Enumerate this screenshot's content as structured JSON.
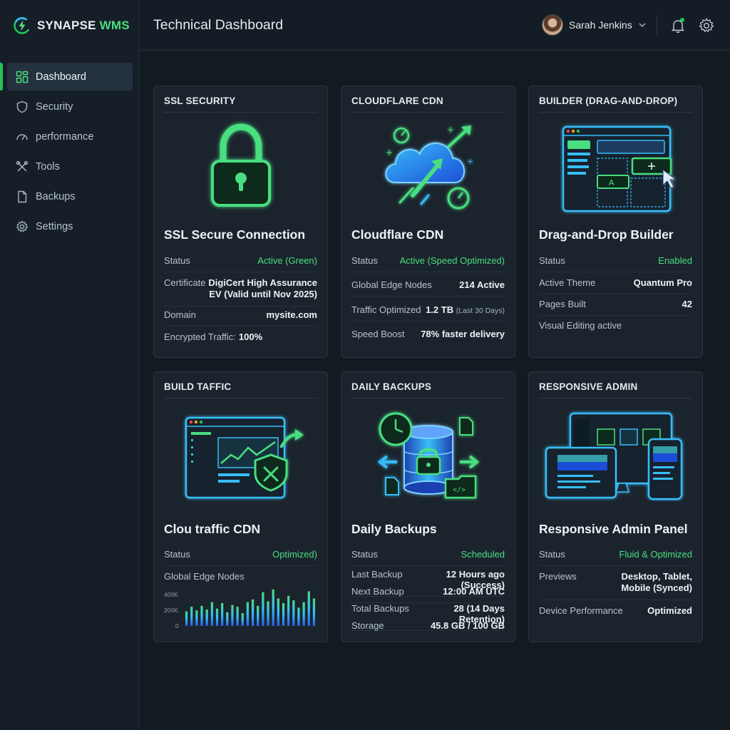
{
  "brand": {
    "part1": "SYNAPSE",
    "part2": "WMS"
  },
  "header": {
    "title": "Technical Dashboard",
    "user_name": "Sarah Jenkins"
  },
  "sidebar": {
    "items": [
      {
        "label": "Dashboard",
        "icon": "grid-icon",
        "active": true
      },
      {
        "label": "Security",
        "icon": "shield-icon"
      },
      {
        "label": "performance",
        "icon": "gauge-icon"
      },
      {
        "label": "Tools",
        "icon": "tools-icon"
      },
      {
        "label": "Backups",
        "icon": "file-icon"
      },
      {
        "label": "Settings",
        "icon": "gear-icon"
      }
    ]
  },
  "colors": {
    "accent": "#4ade80",
    "brand_green": "#22c55e",
    "cyan": "#38bdf8",
    "bg": "#121a22",
    "card": "#1b242d"
  },
  "cards": {
    "ssl": {
      "header": "SSL SECURITY",
      "title": "SSL Secure Connection",
      "status_label": "Status",
      "status_value": "Active (Green)",
      "cert_label": "Certificate",
      "cert_value_1": "DigiCert High Assurance",
      "cert_value_2": "EV (Valid until Nov 2025)",
      "domain_label": "Domain",
      "domain_value": "mysite.com",
      "traffic_label": "Encrypted Traffic:",
      "traffic_value": "100%"
    },
    "cdn": {
      "header": "CLOUDFLARE CDN",
      "title": "Cloudflare CDN",
      "status_label": "Status",
      "status_value": "Active (Speed Optimized)",
      "nodes_label": "Global Edge Nodes",
      "nodes_value": "214 Active",
      "traffic_label": "Traffic Optimized",
      "traffic_value": "1.2 TB",
      "traffic_period": "(Last 30 Days)",
      "boost_label": "Speed Boost",
      "boost_value": "78% faster delivery"
    },
    "builder": {
      "header": "BUILDER (DRAG-AND-DROP)",
      "title": "Drag-and-Drop Builder",
      "status_label": "Status",
      "status_value": "Enabled",
      "theme_label": "Active Theme",
      "theme_value": "Quantum Pro",
      "pages_label": "Pages Built",
      "pages_value": "42",
      "visual_label": "Visual Editing active"
    },
    "traffic": {
      "header": "BUILD TAFFIC",
      "title": "Clou traffic CDN",
      "status_label": "Status",
      "status_value": "Optimized)",
      "nodes_label": "Global Edge Nodes"
    },
    "backups": {
      "header": "DAILY BACKUPS",
      "title": "Daily Backups",
      "status_label": "Status",
      "status_value": "Scheduled",
      "last_label": "Last Backup",
      "last_value": "12 Hours ago (Success)",
      "next_label": "Next Backup",
      "next_value": "12:00 AM UTC",
      "total_label": "Total Backups",
      "total_value": "28 (14 Days Retention)",
      "storage_label": "Storage",
      "storage_value": "45.8 GB / 100 GB"
    },
    "admin": {
      "header": "RESPONSIVE ADMIN",
      "title": "Responsive Admin Panel",
      "status_label": "Status",
      "status_value": "Fluid & Optimized",
      "previews_label": "Previews",
      "previews_value_1": "Desktop, Tablet,",
      "previews_value_2": "Mobile (Synced)",
      "perf_label": "Device Performance",
      "perf_value": "Optimized"
    }
  },
  "chart_data": {
    "type": "bar",
    "ylabel": "",
    "yticks": [
      "400K",
      "200K",
      "0"
    ],
    "ylim": [
      0,
      500000
    ],
    "values": [
      160000,
      210000,
      170000,
      220000,
      180000,
      260000,
      190000,
      250000,
      150000,
      230000,
      210000,
      140000,
      260000,
      290000,
      220000,
      370000,
      270000,
      400000,
      300000,
      250000,
      330000,
      280000,
      200000,
      260000,
      380000,
      300000
    ]
  }
}
